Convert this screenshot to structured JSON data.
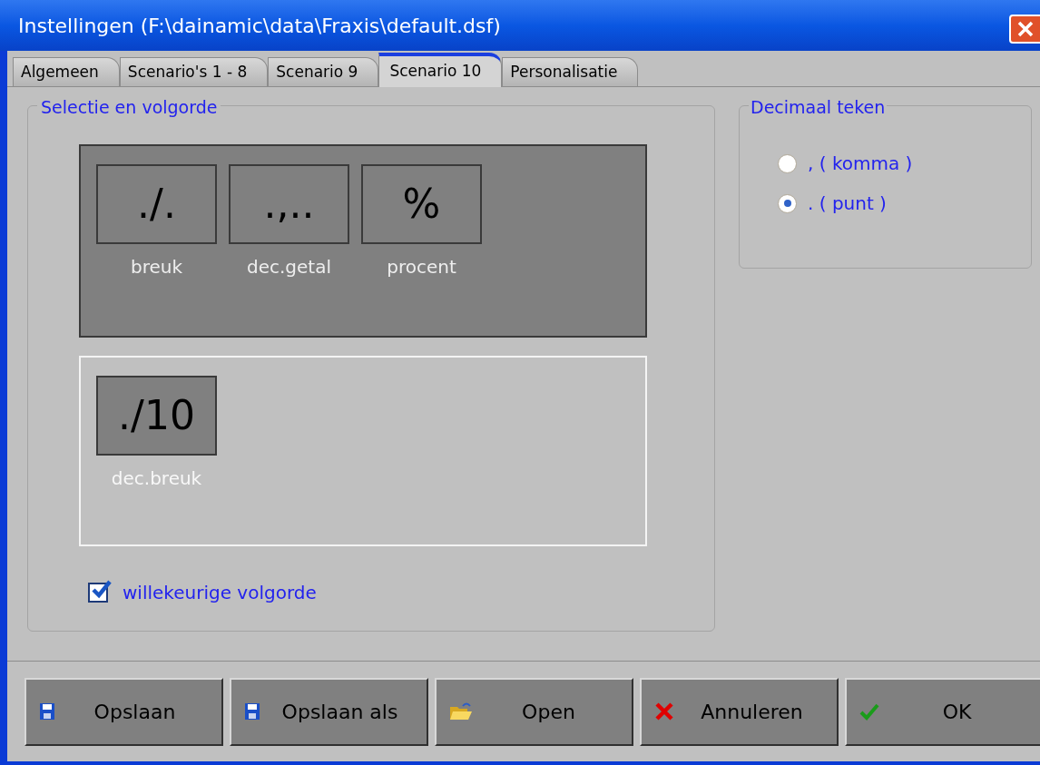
{
  "window": {
    "title": "Instellingen (F:\\dainamic\\data\\Fraxis\\default.dsf)"
  },
  "tabs": [
    {
      "label": "Algemeen",
      "selected": false
    },
    {
      "label": "Scenario's 1 - 8",
      "selected": false
    },
    {
      "label": "Scenario 9",
      "selected": false
    },
    {
      "label": "Scenario 10",
      "selected": true
    },
    {
      "label": "Personalisatie",
      "selected": false
    }
  ],
  "selection": {
    "legend": "Selectie en volgorde",
    "chosen_items": [
      {
        "symbol": "./.",
        "label": "breuk"
      },
      {
        "symbol": ".,..",
        "label": "dec.getal"
      },
      {
        "symbol": "%",
        "label": "procent"
      }
    ],
    "available_items": [
      {
        "symbol": "./10",
        "label": "dec.breuk"
      }
    ],
    "random_order": {
      "label": "willekeurige volgorde",
      "checked": true
    }
  },
  "decimal_sign": {
    "legend": "Decimaal teken",
    "options": [
      {
        "label": ", ( komma )",
        "selected": false
      },
      {
        "label": ". ( punt )",
        "selected": true
      }
    ]
  },
  "buttons": [
    {
      "label": "Opslaan",
      "kind": "save"
    },
    {
      "label": "Opslaan als",
      "kind": "save"
    },
    {
      "label": "Open",
      "kind": "open"
    },
    {
      "label": "Annuleren",
      "kind": "cancel"
    },
    {
      "label": "OK",
      "kind": "ok"
    }
  ]
}
